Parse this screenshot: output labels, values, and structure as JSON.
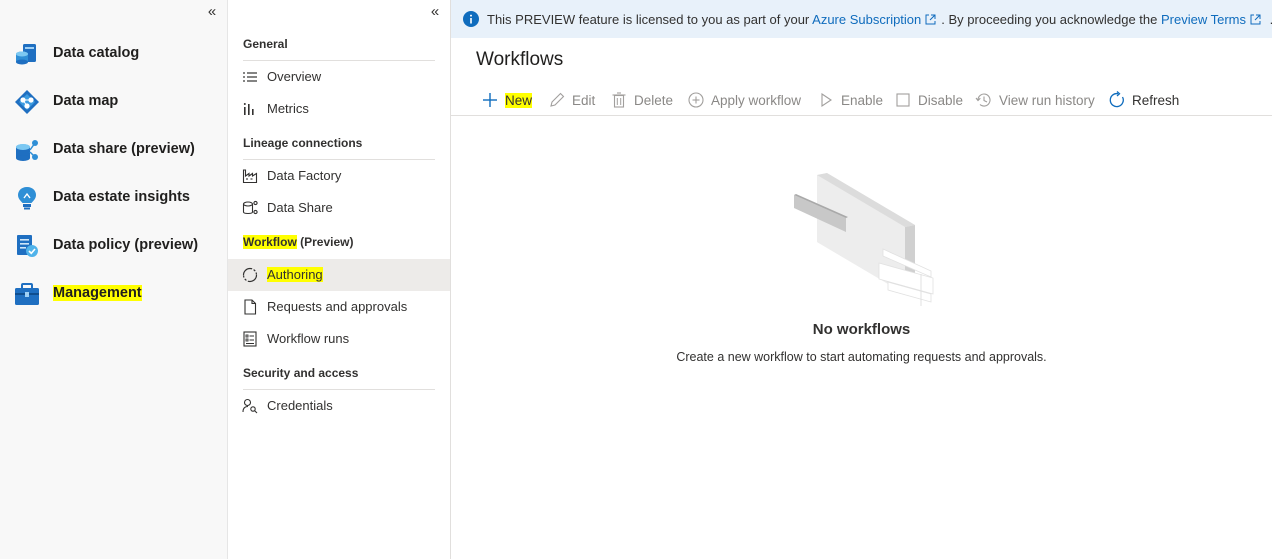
{
  "rail": {
    "collapse_glyph": "«",
    "items": [
      {
        "label": "Data catalog",
        "icon": "data-catalog-icon"
      },
      {
        "label": "Data map",
        "icon": "data-map-icon"
      },
      {
        "label": "Data share (preview)",
        "icon": "data-share-icon"
      },
      {
        "label": "Data estate insights",
        "icon": "insights-bulb-icon"
      },
      {
        "label": "Data policy (preview)",
        "icon": "data-policy-icon"
      },
      {
        "label": "Management",
        "icon": "management-toolbox-icon",
        "highlighted": true
      }
    ]
  },
  "subnav": {
    "collapse_glyph": "«",
    "sections": [
      {
        "title": "General",
        "items": [
          {
            "label": "Overview",
            "icon": "list-icon"
          },
          {
            "label": "Metrics",
            "icon": "metrics-icon"
          }
        ]
      },
      {
        "title": "Lineage connections",
        "items": [
          {
            "label": "Data Factory",
            "icon": "factory-icon"
          },
          {
            "label": "Data Share",
            "icon": "data-share-outline-icon"
          }
        ]
      },
      {
        "title_highlight": "Workflow",
        "title_rest": " (Preview)",
        "items": [
          {
            "label": "Authoring",
            "icon": "authoring-cycle-icon",
            "active": true,
            "highlighted": true
          },
          {
            "label": "Requests and approvals",
            "icon": "document-icon"
          },
          {
            "label": "Workflow runs",
            "icon": "checklist-icon"
          }
        ]
      },
      {
        "title": "Security and access",
        "items": [
          {
            "label": "Credentials",
            "icon": "credentials-icon"
          }
        ]
      }
    ]
  },
  "banner": {
    "text_1": "This PREVIEW feature is licensed to you as part of your ",
    "link_1": "Azure Subscription",
    "text_2": ". By proceeding you acknowledge the ",
    "link_2": "Preview Terms",
    "text_3": " ..."
  },
  "main": {
    "title": "Workflows",
    "toolbar": {
      "new": "New",
      "edit": "Edit",
      "delete": "Delete",
      "apply": "Apply workflow",
      "enable": "Enable",
      "disable": "Disable",
      "history": "View run history",
      "refresh": "Refresh"
    },
    "empty": {
      "title": "No workflows",
      "subtitle": "Create a new workflow to start automating requests and approvals."
    }
  },
  "colors": {
    "accent": "#0f6cbd",
    "highlight": "#ffff00",
    "banner_bg": "#e8f1fa"
  }
}
